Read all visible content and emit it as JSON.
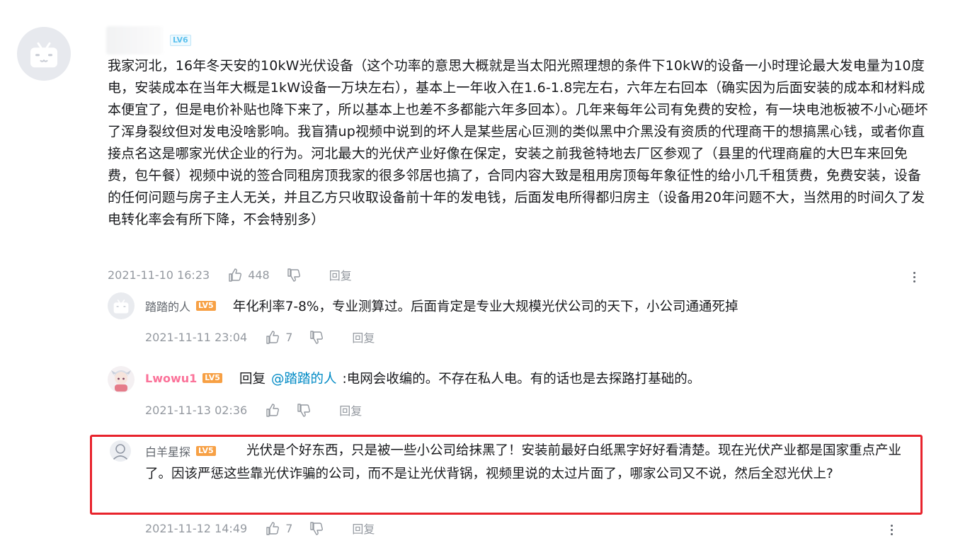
{
  "main_comment": {
    "level_badge": "LV6",
    "text": "我家河北，16年冬天安的10kW光伏设备（这个功率的意思大概就是当太阳光照理想的条件下10kW的设备一小时理论最大发电量为10度电，安装成本在当年大概是1kW设备一万块左右），基本上一年收入在1.6-1.8完左右，六年左右回本（确实因为后面安装的成本和材料成本便宜了，但是电价补贴也降下来了，所以基本上也差不多都能六年多回本）。几年来每年公司有免费的安检，有一块电池板被不小心砸坏了浑身裂纹但对发电没啥影响。我盲猜up视频中说到的坏人是某些居心叵测的类似黑中介黑没有资质的代理商干的想搞黑心钱，或者你直接点名这是哪家光伏企业的行为。河北最大的光伏产业好像在保定，安装之前我爸特地去厂区参观了（县里的代理商雇的大巴车来回免费，包午餐）视频中说的签合同租房顶我家的很多邻居也搞了，合同内容大致是租用房顶每年象征性的给小几千租赁费，免费安装，设备的任何问题与房子主人无关，并且乙方只收取设备前十年的发电钱，后面发电所得都归房主（设备用20年问题不大，当然用的时间久了发电转化率会有所下降，不会特别多）",
    "time": "2021-11-10 16:23",
    "likes": "448",
    "reply_label": "回复"
  },
  "replies": [
    {
      "name": "踏踏的人",
      "level": "LV5",
      "text": "年化利率7-8%，专业测算过。后面肯定是专业大规模光伏公司的天下，小公司通通死掉",
      "time": "2021-11-11 23:04",
      "likes": "7",
      "reply_label": "回复"
    },
    {
      "name": "Lwowu1",
      "level": "LV5",
      "reply_prefix": "回复",
      "mention": "@踏踏的人",
      "text": ":电网会收编的。不存在私人电。有的话也是去探路打基础的。",
      "time": "2021-11-13 02:36",
      "reply_label": "回复"
    },
    {
      "name": "白羊星探",
      "level": "LV5",
      "text": "光伏是个好东西，只是被一些小公司给抹黑了！安装前最好白纸黑字好好看清楚。现在光伏产业都是国家重点产业了。因该严惩这些靠光伏诈骗的公司，而不是让光伏背锅，视频里说的太过片面了，哪家公司又不说，然后全怼光伏上?",
      "time": "2021-11-12 14:49",
      "likes": "7",
      "reply_label": "回复"
    }
  ],
  "colors": {
    "highlight_border": "#e8232c",
    "meta_text": "#9499a0",
    "link": "#008ac5",
    "vip_name": "#fb7299",
    "level_orange": "#f7a044",
    "level_blue": "#5cc1ee"
  },
  "icons": [
    "avatar-tv-icon",
    "thumb-up-icon",
    "thumb-down-icon",
    "more-vertical-icon"
  ]
}
